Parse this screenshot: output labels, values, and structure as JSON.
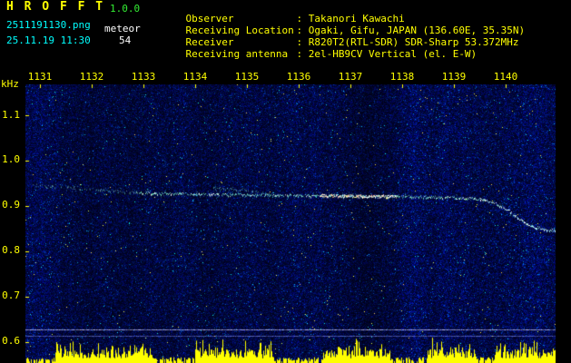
{
  "header": {
    "app_title": "H R O F F T",
    "version": "1.0.0",
    "filename": "2511191130.png",
    "mode": "meteor",
    "datetime": "25.11.19 11:30",
    "count": "54",
    "colon": ": ",
    "info_rows": [
      {
        "label": "Observer",
        "value": "Takanori Kawachi"
      },
      {
        "label": "Receiving Location",
        "value": "Ogaki, Gifu, JAPAN (136.60E, 35.35N)"
      },
      {
        "label": "Receiver",
        "value": "R820T2(RTL-SDR) SDR-Sharp 53.372MHz"
      },
      {
        "label": "Receiving antenna",
        "value": "2el-HB9CV Vertical (el. E-W)"
      }
    ]
  },
  "colors": {
    "bg": "#000000",
    "yellow": "#ffff00",
    "green": "#33ee33",
    "cyan": "#00ffff",
    "white": "#ffffff",
    "noise_base": "#000a50",
    "bars": "#ffff00"
  },
  "chart_data": {
    "type": "heatmap",
    "ylabel": "kHz",
    "x_tick_labels": [
      "1131",
      "1132",
      "1133",
      "1134",
      "1135",
      "1136",
      "1137",
      "1138",
      "1139",
      "1140"
    ],
    "y_tick_labels": [
      "1.1",
      "1.0",
      "0.9",
      "0.8",
      "0.7",
      "0.6"
    ],
    "y_tick_khz": [
      1.1,
      1.0,
      0.9,
      0.8,
      0.7,
      0.6
    ],
    "ylim_khz": [
      0.57,
      1.17
    ],
    "time_span_hhmm": [
      "11:30",
      "11:40"
    ],
    "trace_segments": [
      {
        "style": "faint",
        "points": [
          [
            0.014,
            0.947
          ],
          [
            0.132,
            0.936
          ],
          [
            0.209,
            0.93
          ]
        ]
      },
      {
        "style": "normal",
        "points": [
          [
            0.209,
            0.93
          ],
          [
            0.346,
            0.926
          ],
          [
            0.5,
            0.924
          ],
          [
            0.671,
            0.922
          ],
          [
            0.791,
            0.92
          ],
          [
            0.859,
            0.916
          ]
        ]
      },
      {
        "style": "faint",
        "points": [
          [
            0.354,
            0.941
          ],
          [
            0.466,
            0.928
          ]
        ]
      },
      {
        "style": "hot",
        "points": [
          [
            0.555,
            0.9235
          ],
          [
            0.7,
            0.9215
          ]
        ]
      },
      {
        "style": "bright",
        "points": [
          [
            0.859,
            0.916
          ],
          [
            0.89,
            0.905
          ],
          [
            0.911,
            0.893
          ],
          [
            0.932,
            0.872
          ],
          [
            0.953,
            0.856
          ],
          [
            1.0,
            0.846
          ]
        ]
      }
    ],
    "horizontal_lines_khz": [
      0.628,
      0.614
    ],
    "activity_bursts_frac": [
      [
        0.055,
        0.243
      ],
      [
        0.32,
        0.466
      ],
      [
        0.56,
        0.688
      ],
      [
        0.757,
        0.851
      ],
      [
        0.885,
        1.0
      ]
    ]
  }
}
